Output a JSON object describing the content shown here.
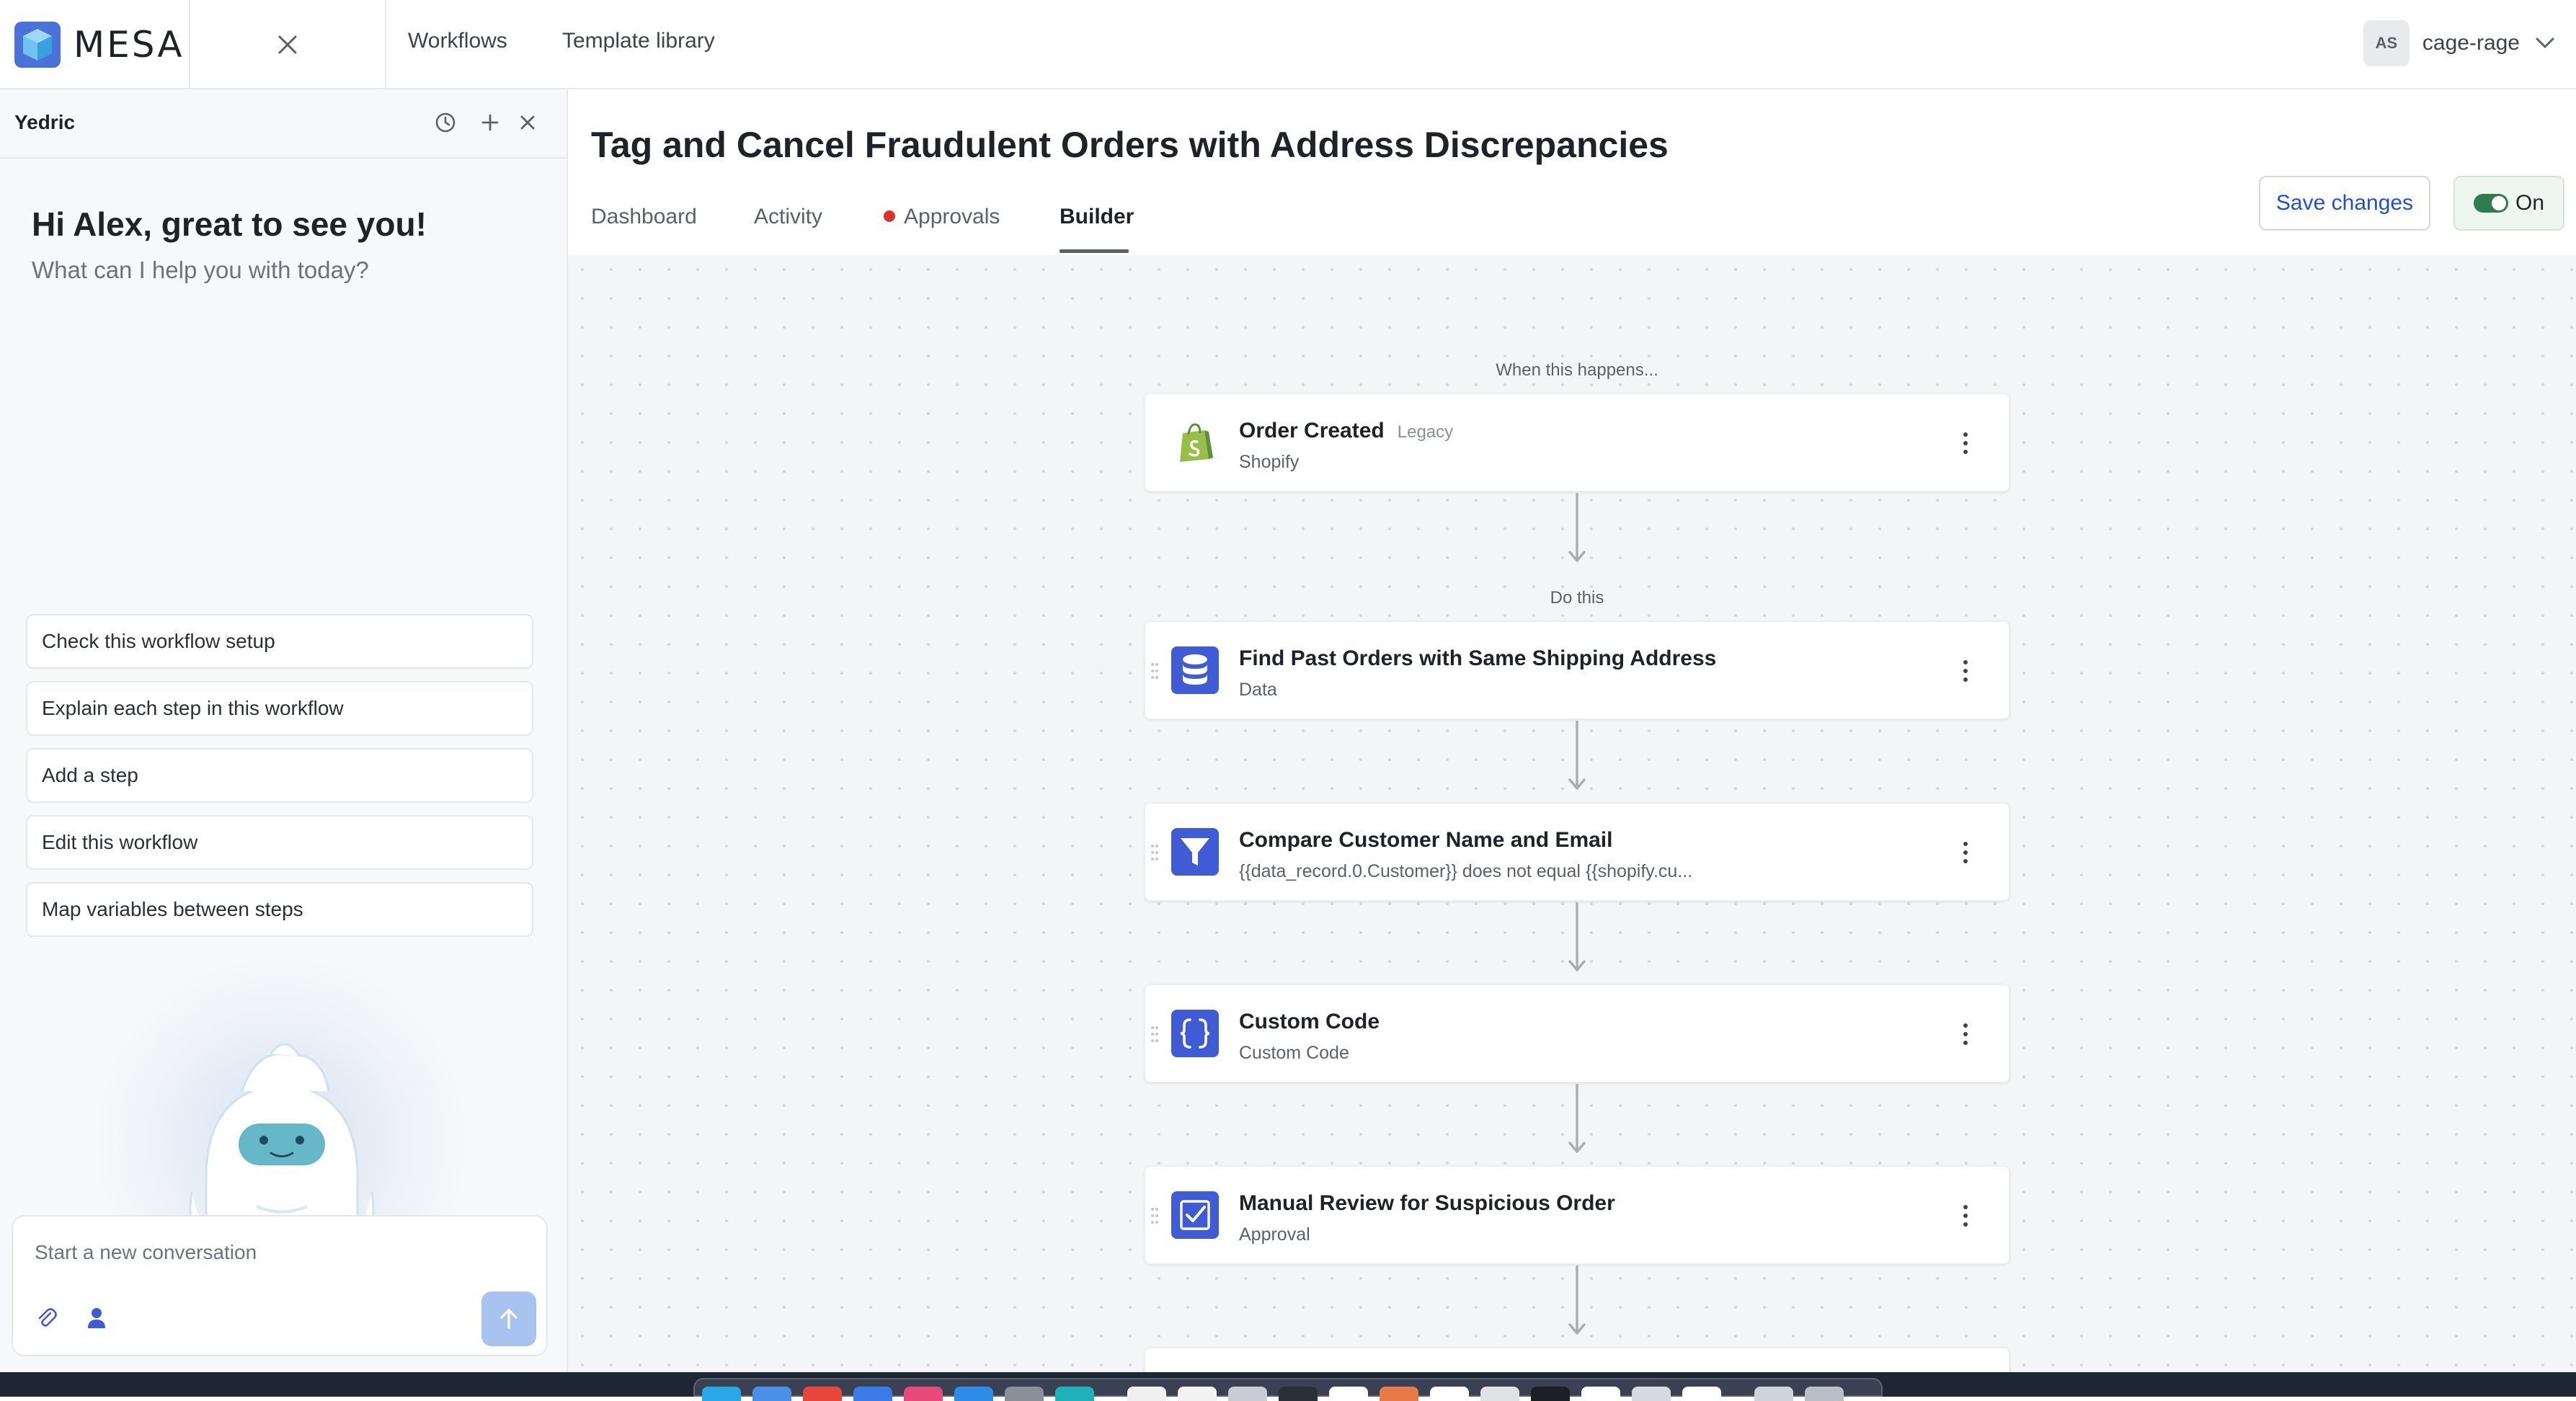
{
  "app": {
    "logo_text": "MESA"
  },
  "topnav": {
    "workflows": "Workflows",
    "template_library": "Template library"
  },
  "user": {
    "initials": "AS",
    "name": "cage-rage"
  },
  "assistant": {
    "name": "Yedric",
    "greeting": "Hi Alex, great to see you!",
    "subgreeting": "What can I help you with today?",
    "suggestions": [
      "Check this workflow setup",
      "Explain each step in this workflow",
      "Add a step",
      "Edit this workflow",
      "Map variables between steps"
    ],
    "composer_placeholder": "Start a new conversation"
  },
  "workflow": {
    "title": "Tag and Cancel Fraudulent Orders with Address Discrepancies",
    "tabs": [
      "Dashboard",
      "Activity",
      "Approvals",
      "Builder"
    ],
    "active_tab": "Builder",
    "save_label": "Save changes",
    "toggle_label": "On",
    "toggle_on": true
  },
  "builder": {
    "trigger_label": "When this happens...",
    "action_label": "Do this",
    "steps": [
      {
        "title": "Order Created",
        "tag": "Legacy",
        "subtitle": "Shopify",
        "icon": "shopify-icon"
      },
      {
        "title": "Find Past Orders with Same Shipping Address",
        "tag": "",
        "subtitle": "Data",
        "icon": "database-icon"
      },
      {
        "title": "Compare Customer Name and Email",
        "tag": "",
        "subtitle": "{{data_record.0.Customer}} does not equal {{shopify.cu...",
        "icon": "filter-icon"
      },
      {
        "title": "Custom Code",
        "tag": "",
        "subtitle": "Custom Code",
        "icon": "code-braces-icon"
      },
      {
        "title": "Manual Review for Suspicious Order",
        "tag": "",
        "subtitle": "Approval",
        "icon": "approval-checkbox-icon"
      }
    ]
  },
  "colors": {
    "accent_blue": "#1d4fd8",
    "step_icon_blue": "#3f5bd6",
    "toggle_green": "#2f7d4f",
    "approvals_dot_red": "#d9342b",
    "shopify_green": "#95bf47"
  }
}
